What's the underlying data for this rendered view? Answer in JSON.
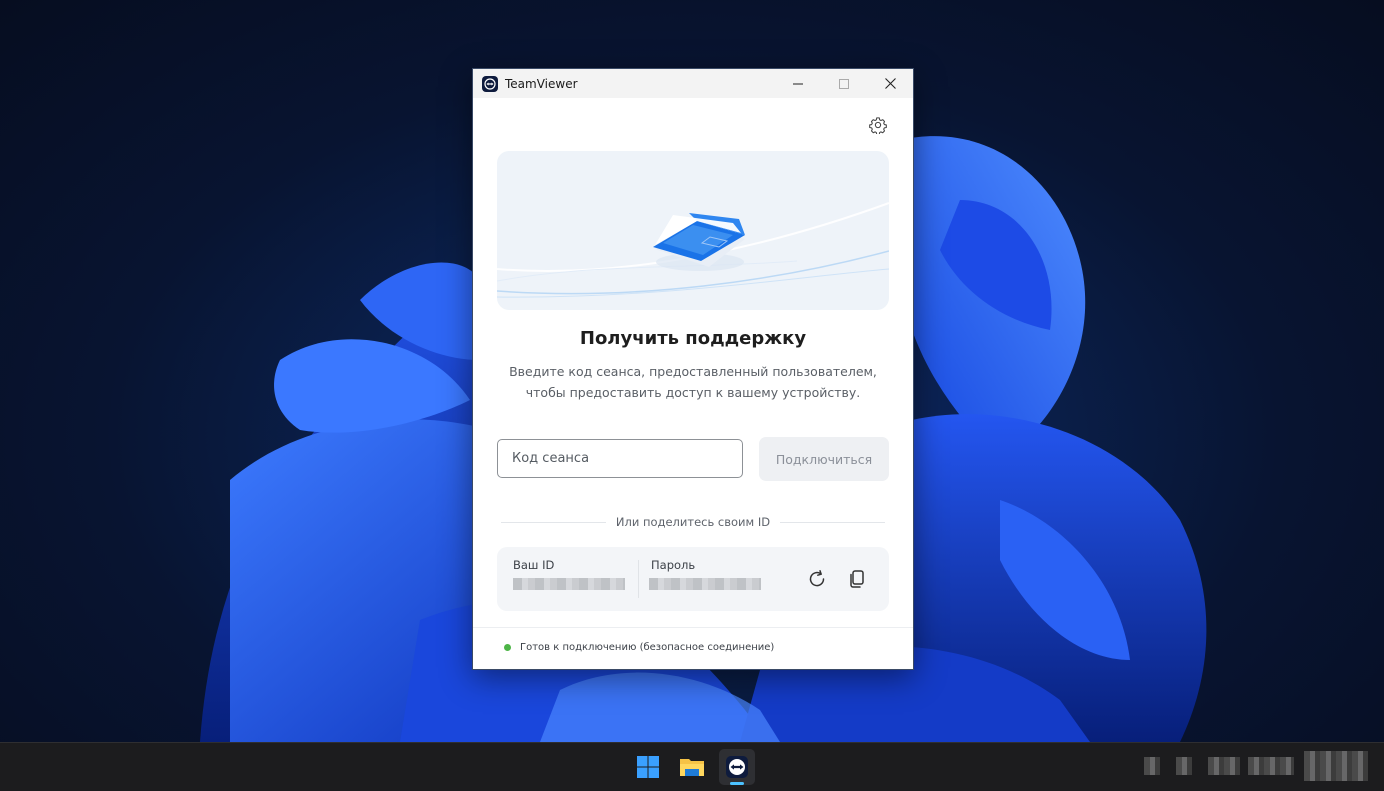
{
  "window": {
    "title": "TeamViewer"
  },
  "support": {
    "heading": "Получить поддержку",
    "description": "Введите код сеанса, предоставленный пользователем, чтобы предоставить доступ к вашему устройству.",
    "code_placeholder": "Код сеанса",
    "connect_label": "Подключиться",
    "share_divider": "Или поделитесь своим ID"
  },
  "credentials": {
    "id_label": "Ваш ID",
    "password_label": "Пароль"
  },
  "status": {
    "text": "Готов к подключению (безопасное соединение)",
    "color": "#4db547"
  },
  "taskbar": {
    "items": [
      "start-icon",
      "file-explorer-icon",
      "teamviewer-icon"
    ],
    "active_item": "teamviewer-icon",
    "accent": "#4cc2ff"
  },
  "colors": {
    "brand": "#0e1b3d",
    "hero_accent": "#1a73e8"
  }
}
